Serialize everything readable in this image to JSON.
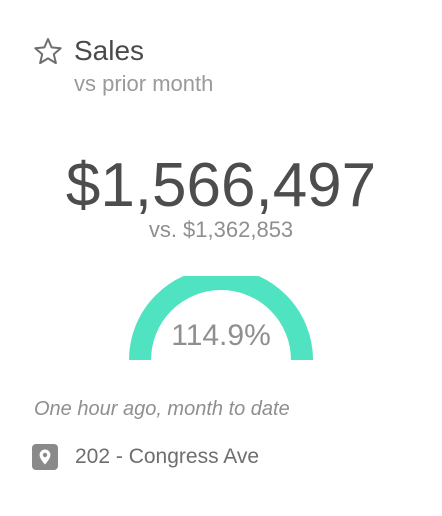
{
  "card": {
    "title": "Sales",
    "subtitle": "vs prior month",
    "favorite_icon": "star-outline-icon",
    "main_value": "$1,566,497",
    "comparison_value": "vs. $1,362,853",
    "gauge": {
      "display_value": "114.9%",
      "fill_percent": 100,
      "color": "#4fe3c2"
    },
    "updated_text": "One hour ago, month to date",
    "location": {
      "icon": "map-pin-icon",
      "label": "202 - Congress Ave"
    }
  }
}
